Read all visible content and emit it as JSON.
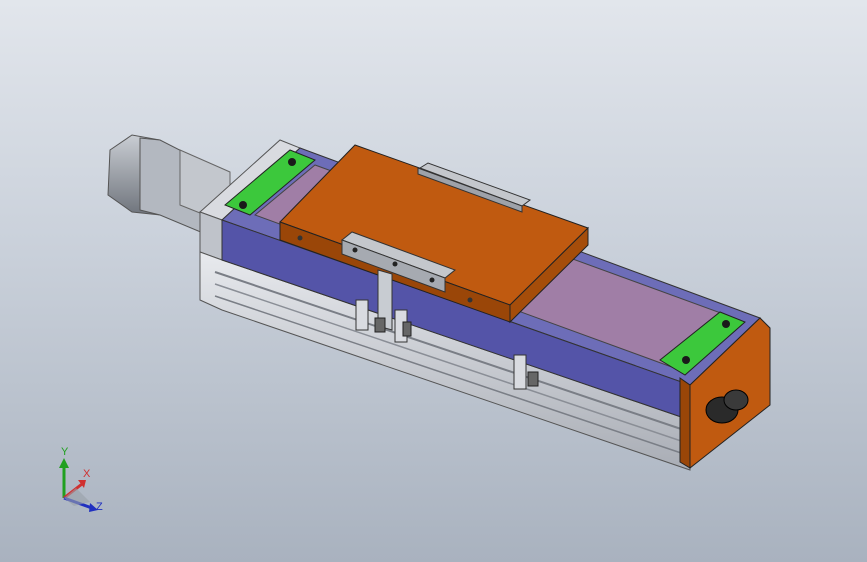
{
  "triad": {
    "x_label": "X",
    "y_label": "Y",
    "z_label": "Z",
    "x_color": "#d03030",
    "y_color": "#20a020",
    "z_color": "#2030c0"
  },
  "colors": {
    "carriage": "#c05a10",
    "rail_body": "#5a5ab0",
    "rail_top": "#9c7aa0",
    "bracket": "#3ac03a",
    "aluminum": "#c8ccd2",
    "motor": "#9aa0a8",
    "endcap": "#b85a10"
  }
}
